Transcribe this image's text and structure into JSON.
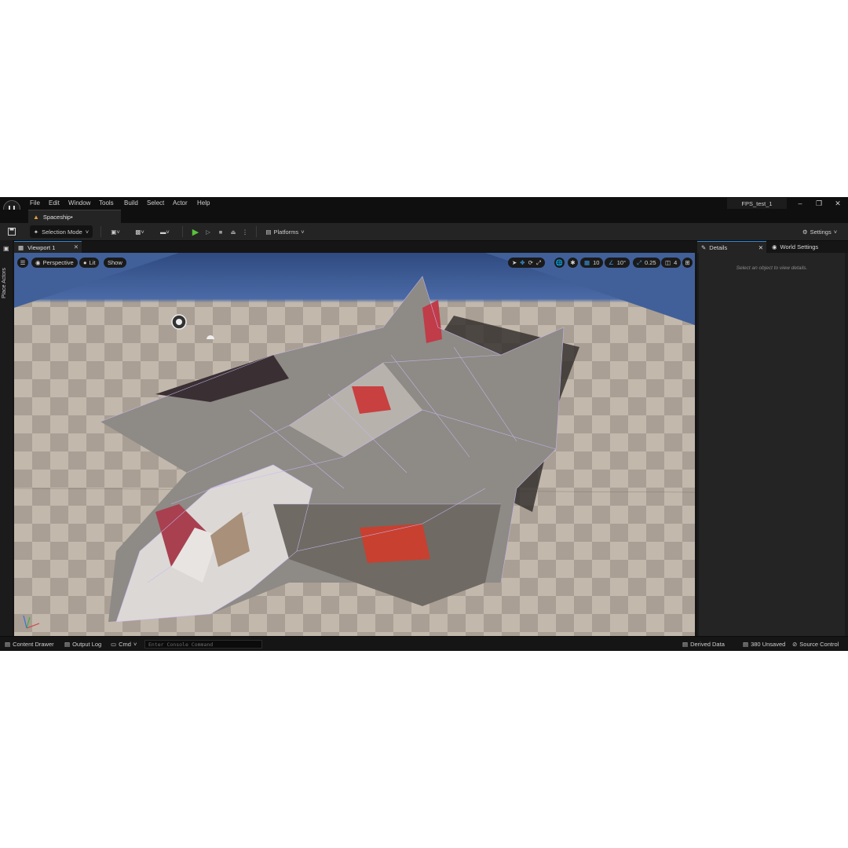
{
  "menu": {
    "logo": "U",
    "items": [
      "File",
      "Edit",
      "Window",
      "Tools",
      "Build",
      "Select",
      "Actor",
      "Help"
    ],
    "project_name": "FPS_test_1"
  },
  "level_tab": {
    "label": "Spaceship•"
  },
  "toolbar": {
    "selection_mode": "Selection Mode",
    "platforms": "Platforms",
    "settings": "Settings"
  },
  "left_strip": {
    "place_actors": "Place Actors"
  },
  "viewport": {
    "tab_label": "Viewport 1",
    "perspective": "Perspective",
    "lit": "Lit",
    "show": "Show",
    "grid_snap": "10",
    "rotation_snap": "10°",
    "scale_snap": "0.25",
    "camera_speed": "4"
  },
  "right_panel": {
    "details_tab": "Details",
    "world_settings_tab": "World Settings",
    "empty_hint": "Select an object to view details."
  },
  "status_bar": {
    "content_drawer": "Content Drawer",
    "output_log": "Output Log",
    "cmd": "Cmd",
    "console_placeholder": "Enter Console Command",
    "derived_data": "Derived Data",
    "unsaved": "380 Unsaved",
    "source_control": "Source Control"
  },
  "colors": {
    "accent_blue": "#2f86d8",
    "play_green": "#59c23a",
    "level_icon": "#e2a33c"
  }
}
